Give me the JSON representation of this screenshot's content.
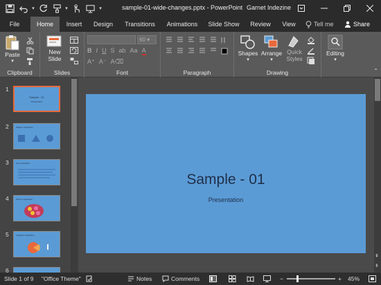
{
  "app": {
    "file_name": "sample-01-wide-changes.pptx - PowerPoint",
    "user": "Garnet Indezine"
  },
  "tabs": [
    {
      "label": "File"
    },
    {
      "label": "Home"
    },
    {
      "label": "Insert"
    },
    {
      "label": "Design"
    },
    {
      "label": "Transitions"
    },
    {
      "label": "Animations"
    },
    {
      "label": "Slide Show"
    },
    {
      "label": "Review"
    },
    {
      "label": "View"
    }
  ],
  "tell_me": "Tell me",
  "share": "Share",
  "ribbon": {
    "clipboard": {
      "paste": "Paste",
      "label": "Clipboard"
    },
    "slides": {
      "new_slide_line1": "New",
      "new_slide_line2": "Slide",
      "label": "Slides"
    },
    "font": {
      "size": "60",
      "label": "Font"
    },
    "paragraph": {
      "label": "Paragraph"
    },
    "drawing": {
      "shapes": "Shapes",
      "arrange": "Arrange",
      "quick_styles_1": "Quick",
      "quick_styles_2": "Styles",
      "label": "Drawing"
    },
    "editing": {
      "label": "Editing"
    }
  },
  "thumbnails": [
    {
      "num": "1",
      "title": "Sample - 01",
      "sub": "Presentation"
    },
    {
      "num": "2",
      "title": "Shapes Inspiration"
    },
    {
      "num": "3",
      "title": "Text Inspiration"
    },
    {
      "num": "4",
      "title": "Picture Inspiration"
    },
    {
      "num": "5",
      "title": "Graphics Inspiration"
    },
    {
      "num": "6",
      "title": ""
    }
  ],
  "slide": {
    "title": "Sample - 01",
    "subtitle": "Presentation"
  },
  "status": {
    "slide_of": "Slide 1 of 9",
    "theme": "\"Office Theme\"",
    "notes": "Notes",
    "comments": "Comments",
    "zoom": "45%"
  },
  "colors": {
    "slide_bg": "#5b9bd5",
    "accent_selected": "#e8693a"
  }
}
